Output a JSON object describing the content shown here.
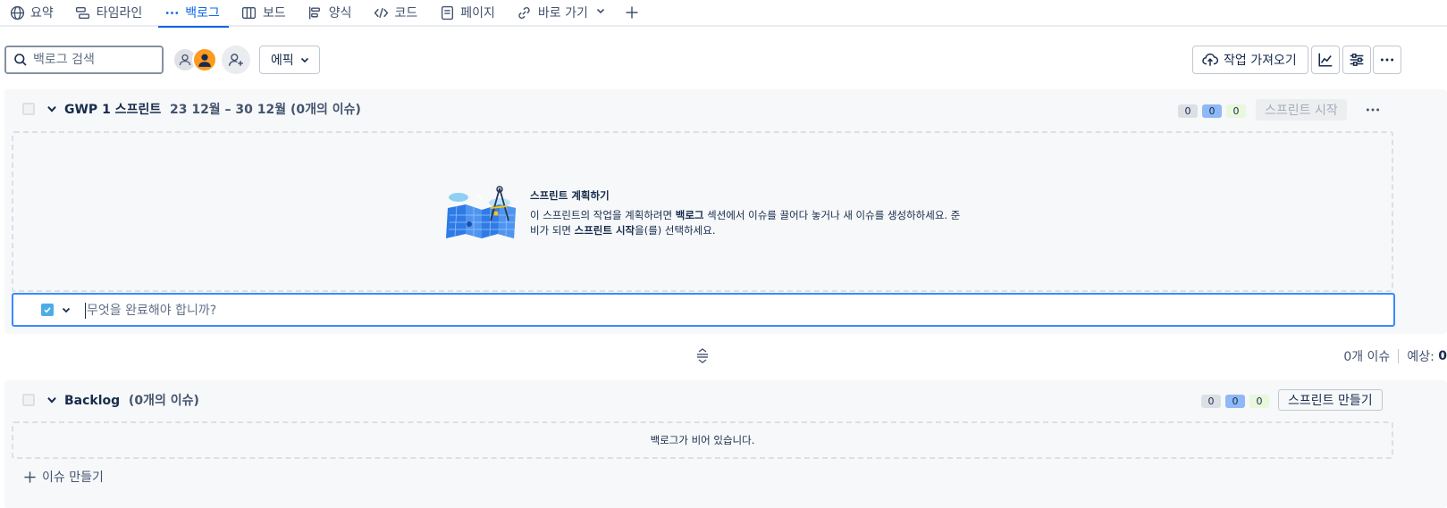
{
  "tabs": [
    {
      "label": "요약",
      "icon": "globe-icon"
    },
    {
      "label": "타임라인",
      "icon": "timeline-icon"
    },
    {
      "label": "백로그",
      "icon": "backlog-icon",
      "active": true
    },
    {
      "label": "보드",
      "icon": "board-icon"
    },
    {
      "label": "양식",
      "icon": "form-icon"
    },
    {
      "label": "코드",
      "icon": "code-icon"
    },
    {
      "label": "페이지",
      "icon": "page-icon"
    },
    {
      "label": "바로 가기",
      "icon": "link-icon"
    }
  ],
  "toolbar": {
    "search_placeholder": "백로그 검색",
    "epic_label": "에픽",
    "import_label": "작업 가져오기"
  },
  "sprint": {
    "title": "GWP 1 스프린트",
    "meta": "23 12월 – 30 12월 (0개의 이슈)",
    "counts": [
      "0",
      "0",
      "0"
    ],
    "start_label": "스프린트 시작",
    "empty_title": "스프린트 계획하기",
    "empty_text_1": "이 스프린트의 작업을 계획하려면 ",
    "empty_text_bold_1": "백로그",
    "empty_text_2": " 섹션에서 이슈를 끌어다 놓거나 새 이슈를 생성하하세요. 준비가 되면 ",
    "empty_text_bold_2": "스프린트 시작",
    "empty_text_3": "을(를) 선택하세요.",
    "create_placeholder": "무엇을 완료해야 합니까?"
  },
  "summary": {
    "issues": "0개 이슈",
    "estimate_label": "예상:",
    "estimate_value": "0"
  },
  "backlog": {
    "title": "Backlog",
    "meta": "(0개의 이슈)",
    "counts": [
      "0",
      "0",
      "0"
    ],
    "create_sprint_label": "스프린트 만들기",
    "empty_text": "백로그가 비어 있습니다.",
    "create_issue_label": "이슈 만들기"
  },
  "colors": {
    "accent": "#0c66e4",
    "focus_border": "#388bff",
    "panel_bg": "#f7f8f9"
  }
}
